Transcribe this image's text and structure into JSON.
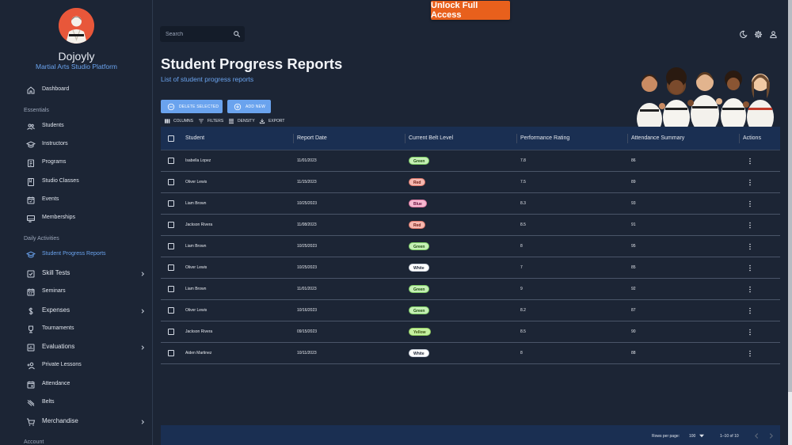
{
  "brand": {
    "name": "Dojoyly",
    "tagline": "Martial Arts Studio Platform"
  },
  "nav": {
    "dashboard": "Dashboard",
    "section_essentials": "Essentials",
    "essentials": [
      "Students",
      "Instructors",
      "Programs",
      "Studio Classes",
      "Events",
      "Memberships"
    ],
    "section_daily": "Daily Activities",
    "daily": [
      "Student Progress Reports",
      "Skill Tests",
      "Seminars",
      "Expenses",
      "Tournaments",
      "Evaluations",
      "Private Lessons",
      "Attendance",
      "Belts",
      "Merchandise"
    ],
    "section_account": "Account",
    "active_item": "Student Progress Reports"
  },
  "topbar": {
    "unlock_label": "Unlock Full Access",
    "search_placeholder": "Search",
    "icons": [
      "moon-icon",
      "gear-icon",
      "user-icon"
    ]
  },
  "page": {
    "title": "Student Progress Reports",
    "subtitle": "List of student progress reports"
  },
  "actions": {
    "delete_selected": "DELETE SELECTED",
    "add_new": "ADD NEW"
  },
  "toolbar": {
    "columns": "COLUMNS",
    "filters": "FILTERS",
    "density": "DENSITY",
    "export": "EXPORT"
  },
  "table": {
    "columns": [
      "Student",
      "Report Date",
      "Current Belt Level",
      "Performance Rating",
      "Attendance Summary",
      "Actions"
    ],
    "rows": [
      {
        "student": "Isabella Lopez",
        "date": "11/01/2023",
        "belt": "Green",
        "rating": "7.8",
        "attendance": "86"
      },
      {
        "student": "Oliver Lewis",
        "date": "11/15/2023",
        "belt": "Red",
        "rating": "7.5",
        "attendance": "89"
      },
      {
        "student": "Liam Brown",
        "date": "10/25/2023",
        "belt": "Blue",
        "rating": "8.3",
        "attendance": "93"
      },
      {
        "student": "Jackson Rivera",
        "date": "11/08/2023",
        "belt": "Red",
        "rating": "8.5",
        "attendance": "91"
      },
      {
        "student": "Liam Brown",
        "date": "10/25/2023",
        "belt": "Green",
        "rating": "8",
        "attendance": "95"
      },
      {
        "student": "Oliver Lewis",
        "date": "10/25/2023",
        "belt": "White",
        "rating": "7",
        "attendance": "85"
      },
      {
        "student": "Liam Brown",
        "date": "11/01/2023",
        "belt": "Green",
        "rating": "9",
        "attendance": "92"
      },
      {
        "student": "Oliver Lewis",
        "date": "10/16/2023",
        "belt": "Green",
        "rating": "8.2",
        "attendance": "87"
      },
      {
        "student": "Jackson Rivera",
        "date": "09/15/2023",
        "belt": "Yellow",
        "rating": "8.5",
        "attendance": "90"
      },
      {
        "student": "Aiden Martinez",
        "date": "10/11/2023",
        "belt": "White",
        "rating": "8",
        "attendance": "88"
      }
    ],
    "belt_colors": {
      "Green": {
        "bg": "#c5f0b5",
        "fg": "#1f4d12",
        "border": "#7fcf66"
      },
      "Red": {
        "bg": "#f5b8b0",
        "fg": "#6b1a12",
        "border": "#e07a6c"
      },
      "Blue": {
        "bg": "#f5b8d0",
        "fg": "#6b1240",
        "border": "#e07aa3"
      },
      "White": {
        "bg": "#ffffff",
        "fg": "#1c2535",
        "border": "#cfd6e0"
      },
      "Yellow": {
        "bg": "#c5f0a0",
        "fg": "#3a5210",
        "border": "#93d060"
      }
    }
  },
  "footer": {
    "rows_per_page_label": "Rows per page:",
    "rows_per_page": "100",
    "range": "1–10 of 10"
  },
  "colors": {
    "accent": "#6aa3ee",
    "cta": "#e8601c",
    "bg": "#1c2535",
    "header": "#1a2f52"
  }
}
